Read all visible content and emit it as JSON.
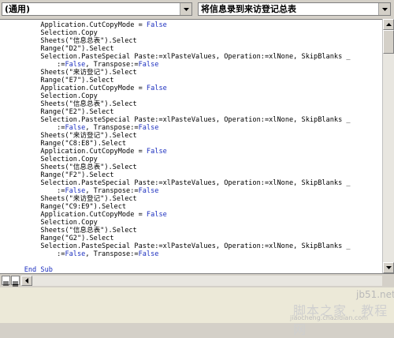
{
  "toolbar": {
    "object_combo_value": "(通用)",
    "procedure_combo_value": "将信息录到来访登记总表"
  },
  "code": {
    "lines": [
      [
        {
          "t": "        Application.CutCopyMode = "
        },
        {
          "t": "False",
          "k": 1
        }
      ],
      [
        {
          "t": "        Selection.Copy"
        }
      ],
      [
        {
          "t": "        Sheets(\"信息总表\").Select"
        }
      ],
      [
        {
          "t": "        Range(\"D2\").Select"
        }
      ],
      [
        {
          "t": "        Selection.PasteSpecial Paste:=xlPasteValues, Operation:=xlNone, SkipBlanks _"
        }
      ],
      [
        {
          "t": "            :="
        },
        {
          "t": "False",
          "k": 1
        },
        {
          "t": ", Transpose:="
        },
        {
          "t": "False",
          "k": 1
        }
      ],
      [
        {
          "t": "        Sheets(\"来访登记\").Select"
        }
      ],
      [
        {
          "t": "        Range(\"E7\").Select"
        }
      ],
      [
        {
          "t": "        Application.CutCopyMode = "
        },
        {
          "t": "False",
          "k": 1
        }
      ],
      [
        {
          "t": "        Selection.Copy"
        }
      ],
      [
        {
          "t": "        Sheets(\"信息总表\").Select"
        }
      ],
      [
        {
          "t": "        Range(\"E2\").Select"
        }
      ],
      [
        {
          "t": "        Selection.PasteSpecial Paste:=xlPasteValues, Operation:=xlNone, SkipBlanks _"
        }
      ],
      [
        {
          "t": "            :="
        },
        {
          "t": "False",
          "k": 1
        },
        {
          "t": ", Transpose:="
        },
        {
          "t": "False",
          "k": 1
        }
      ],
      [
        {
          "t": "        Sheets(\"来访登记\").Select"
        }
      ],
      [
        {
          "t": "        Range(\"C8:E8\").Select"
        }
      ],
      [
        {
          "t": "        Application.CutCopyMode = "
        },
        {
          "t": "False",
          "k": 1
        }
      ],
      [
        {
          "t": "        Selection.Copy"
        }
      ],
      [
        {
          "t": "        Sheets(\"信息总表\").Select"
        }
      ],
      [
        {
          "t": "        Range(\"F2\").Select"
        }
      ],
      [
        {
          "t": "        Selection.PasteSpecial Paste:=xlPasteValues, Operation:=xlNone, SkipBlanks _"
        }
      ],
      [
        {
          "t": "            :="
        },
        {
          "t": "False",
          "k": 1
        },
        {
          "t": ", Transpose:="
        },
        {
          "t": "False",
          "k": 1
        }
      ],
      [
        {
          "t": "        Sheets(\"来访登记\").Select"
        }
      ],
      [
        {
          "t": "        Range(\"C9:E9\").Select"
        }
      ],
      [
        {
          "t": "        Application.CutCopyMode = "
        },
        {
          "t": "False",
          "k": 1
        }
      ],
      [
        {
          "t": "        Selection.Copy"
        }
      ],
      [
        {
          "t": "        Sheets(\"信息总表\").Select"
        }
      ],
      [
        {
          "t": "        Range(\"G2\").Select"
        }
      ],
      [
        {
          "t": "        Selection.PasteSpecial Paste:=xlPasteValues, Operation:=xlNone, SkipBlanks _"
        }
      ],
      [
        {
          "t": "            :="
        },
        {
          "t": "False",
          "k": 1
        },
        {
          "t": ", Transpose:="
        },
        {
          "t": "False",
          "k": 1
        }
      ],
      [
        {
          "t": ""
        }
      ],
      [
        {
          "t": "    "
        },
        {
          "t": "End Sub",
          "k": 1
        }
      ]
    ],
    "keyword_color": "#1c2fbf"
  },
  "icons": {
    "combo_arrow": "chevron-down-icon",
    "scroll_up": "arrow-up-icon",
    "scroll_down": "arrow-down-icon",
    "scroll_left": "arrow-left-icon",
    "procedure_view": "procedure-view-icon",
    "full_module_view": "full-module-view-icon"
  },
  "watermark": {
    "site": "jb51.net",
    "brand": "脚本之家 · 教程网",
    "url": "jiaocheng.chazidian.com"
  }
}
